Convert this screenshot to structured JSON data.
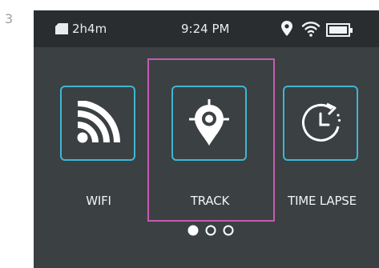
{
  "figure": {
    "step_number": "3"
  },
  "status_bar": {
    "storage_remaining": "2h4m",
    "time": "9:24 PM",
    "icons": [
      "sd-card-icon",
      "location-pin-icon",
      "wifi-icon",
      "battery-icon"
    ]
  },
  "modes": [
    {
      "label": "WIFI",
      "icon": "wifi-icon",
      "selected": false
    },
    {
      "label": "TRACK",
      "icon": "location-target-icon",
      "selected": true
    },
    {
      "label": "TIME LAPSE",
      "icon": "timer-icon",
      "selected": false
    }
  ],
  "pagination": {
    "pages": 3,
    "current": 1
  },
  "colors": {
    "screen_bg": "#3b4043",
    "status_bg": "#2a2d30",
    "tile_border": "#3fb6d6",
    "selection_border": "#c75ab0",
    "text": "#f2f4f5"
  }
}
